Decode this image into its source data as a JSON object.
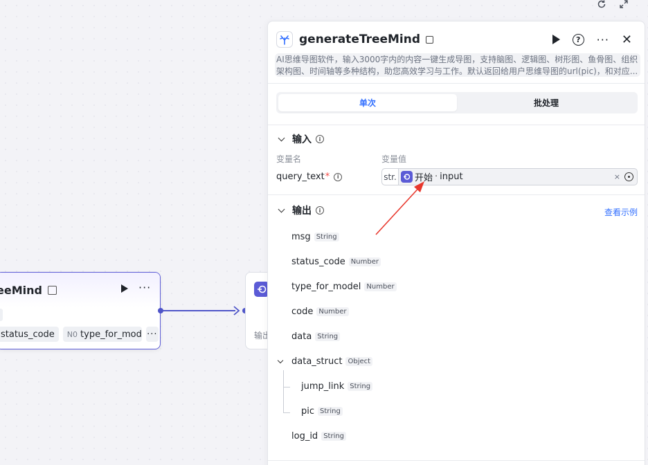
{
  "canvas": {
    "left_node": {
      "title": "eeMind",
      "tags": [
        {
          "type": "",
          "label": "status_code"
        },
        {
          "type": "N0",
          "label": "type_for_model"
        }
      ],
      "more": "···"
    },
    "mid_node": {
      "label": "输出"
    }
  },
  "top_tools": {
    "refresh_icon": "refresh-icon",
    "expand_icon": "expand-icon"
  },
  "panel": {
    "title": "generateTreeMind",
    "description": "AI思维导图软件，输入3000字内的内容一键生成导图，支持脑图、逻辑图、树形图、鱼骨图、组织架构图、时间轴等多种结构，助您高效学习与工作。默认返回给用户思维导图的url(pic)，和对应...",
    "tabs": [
      {
        "label": "单次",
        "active": true
      },
      {
        "label": "批处理",
        "active": false
      }
    ],
    "input_section": {
      "title": "输入",
      "col_name": "变量名",
      "col_value": "变量值",
      "var_name": "query_text",
      "required_mark": "*",
      "type_label": "str.",
      "source_node": "开始",
      "source_sep": "·",
      "source_field": "input",
      "clear": "×"
    },
    "output_section": {
      "title": "输出",
      "view_example": "查看示例",
      "items": [
        {
          "name": "msg",
          "type": "String"
        },
        {
          "name": "status_code",
          "type": "Number"
        },
        {
          "name": "type_for_model",
          "type": "Number"
        },
        {
          "name": "code",
          "type": "Number"
        },
        {
          "name": "data",
          "type": "String"
        },
        {
          "name": "data_struct",
          "type": "Object"
        },
        {
          "name": "jump_link",
          "type": "String"
        },
        {
          "name": "pic",
          "type": "String"
        },
        {
          "name": "log_id",
          "type": "String"
        }
      ]
    }
  },
  "colors": {
    "accent": "#5b5bd6",
    "link": "#3370ff",
    "annotation_arrow": "#e8372c"
  }
}
